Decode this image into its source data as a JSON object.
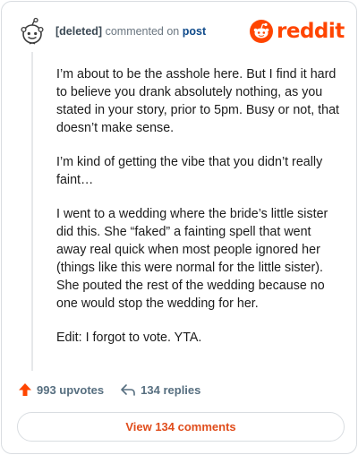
{
  "comment": {
    "author": "[deleted]",
    "action_text": "commented on",
    "target": "post",
    "paragraphs": [
      "I’m about to be the asshole here. But I find it hard to believe you drank absolutely nothing, as you stated in your story, prior to 5pm. Busy or not, that doesn’t make sense.",
      "I’m kind of getting the vibe that you didn’t really faint…",
      "I went to a wedding where the bride’s little sister did this. She “faked” a fainting spell that went away real quick when most people ignored her (things like this were normal for the little sister). She pouted the rest of the wedding because no one would stop the wedding for her.",
      "Edit: I forgot to vote. YTA."
    ]
  },
  "brand": {
    "logo_text": "reddit",
    "color": "#ff4500"
  },
  "stats": {
    "upvotes": "993 upvotes",
    "replies": "134 replies"
  },
  "footer": {
    "view_comments": "View 134 comments"
  },
  "icons": {
    "avatar": "snoo-avatar-icon",
    "upvote": "upvote-arrow-icon",
    "reply": "reply-arrow-icon",
    "logo": "reddit-snoo-logo-icon"
  }
}
